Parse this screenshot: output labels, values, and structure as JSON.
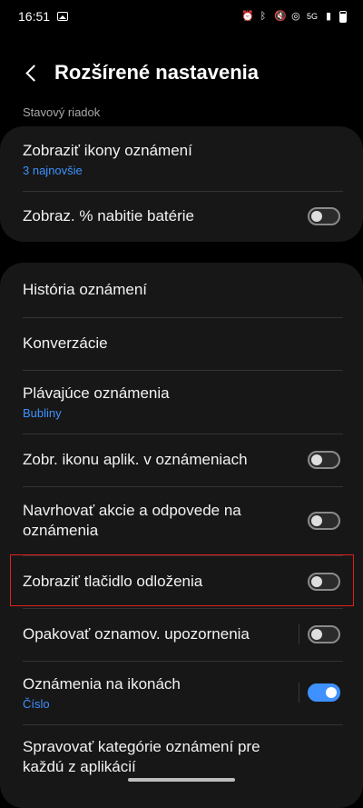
{
  "status_bar": {
    "time": "16:51",
    "left_icons": [
      "gallery-icon"
    ],
    "right_icons": [
      "alarm-icon",
      "bluetooth-icon",
      "mute-icon",
      "hotspot-icon",
      "signal-4g-icon",
      "signal-icon",
      "battery-icon"
    ],
    "network": "5G"
  },
  "header": {
    "title": "Rozšírené nastavenia",
    "back_icon": "back-arrow-icon"
  },
  "section_label": "Stavový riadok",
  "card1": {
    "rows": [
      {
        "title": "Zobraziť ikony oznámení",
        "subtitle": "3 najnovšie"
      },
      {
        "title": "Zobraz. % nabitie batérie",
        "toggle": false
      }
    ]
  },
  "card2": {
    "rows": [
      {
        "title": "História oznámení"
      },
      {
        "title": "Konverzácie"
      },
      {
        "title": "Plávajúce oznámenia",
        "subtitle": "Bubliny"
      },
      {
        "title": "Zobr. ikonu aplik. v oznámeniach",
        "toggle": false
      },
      {
        "title": "Navrhovať akcie a odpovede na oznámenia",
        "toggle": false
      },
      {
        "title": "Zobraziť tlačidlo odloženia",
        "toggle": false
      },
      {
        "title": "Opakovať oznamov. upozornenia",
        "toggle": false
      },
      {
        "title": "Oznámenia na ikonách",
        "subtitle": "Číslo",
        "toggle": true
      },
      {
        "title": "Spravovať kategórie oznámení pre každú z aplikácií"
      }
    ]
  },
  "colors": {
    "background": "#000000",
    "card": "#171717",
    "accent": "#3e91ff",
    "highlight": "#e02020"
  }
}
